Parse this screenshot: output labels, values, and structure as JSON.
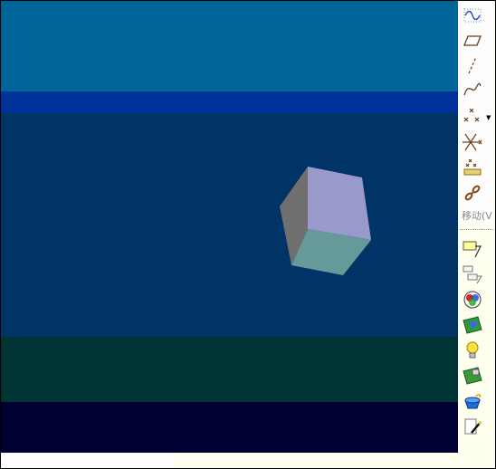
{
  "viewport": {
    "bands": [
      "#006699",
      "#003399",
      "#003366",
      "#003333",
      "#000033"
    ],
    "cube_colors": {
      "top": "#9999cc",
      "left": "#6f6f6f",
      "front": "#669999"
    }
  },
  "toolbar": {
    "tools": [
      {
        "name": "surface-curve-icon",
        "tip": ""
      },
      {
        "name": "plane-icon",
        "tip": ""
      },
      {
        "name": "line-icon",
        "tip": ""
      },
      {
        "name": "spline-icon",
        "tip": ""
      },
      {
        "name": "points-icon",
        "tip": ""
      },
      {
        "name": "intersect-points-icon",
        "tip": ""
      },
      {
        "name": "project-points-icon",
        "tip": ""
      },
      {
        "name": "connect-icon",
        "tip": ""
      }
    ],
    "move_label": "移动(V",
    "lower_tools": [
      {
        "name": "attribute-edit-icon"
      },
      {
        "name": "hierarchy-icon"
      },
      {
        "name": "color-wheel-icon"
      },
      {
        "name": "texture-map-icon"
      },
      {
        "name": "light-bulb-icon"
      },
      {
        "name": "image-map-icon"
      },
      {
        "name": "paint-bucket-icon"
      },
      {
        "name": "edit-document-icon"
      }
    ]
  }
}
